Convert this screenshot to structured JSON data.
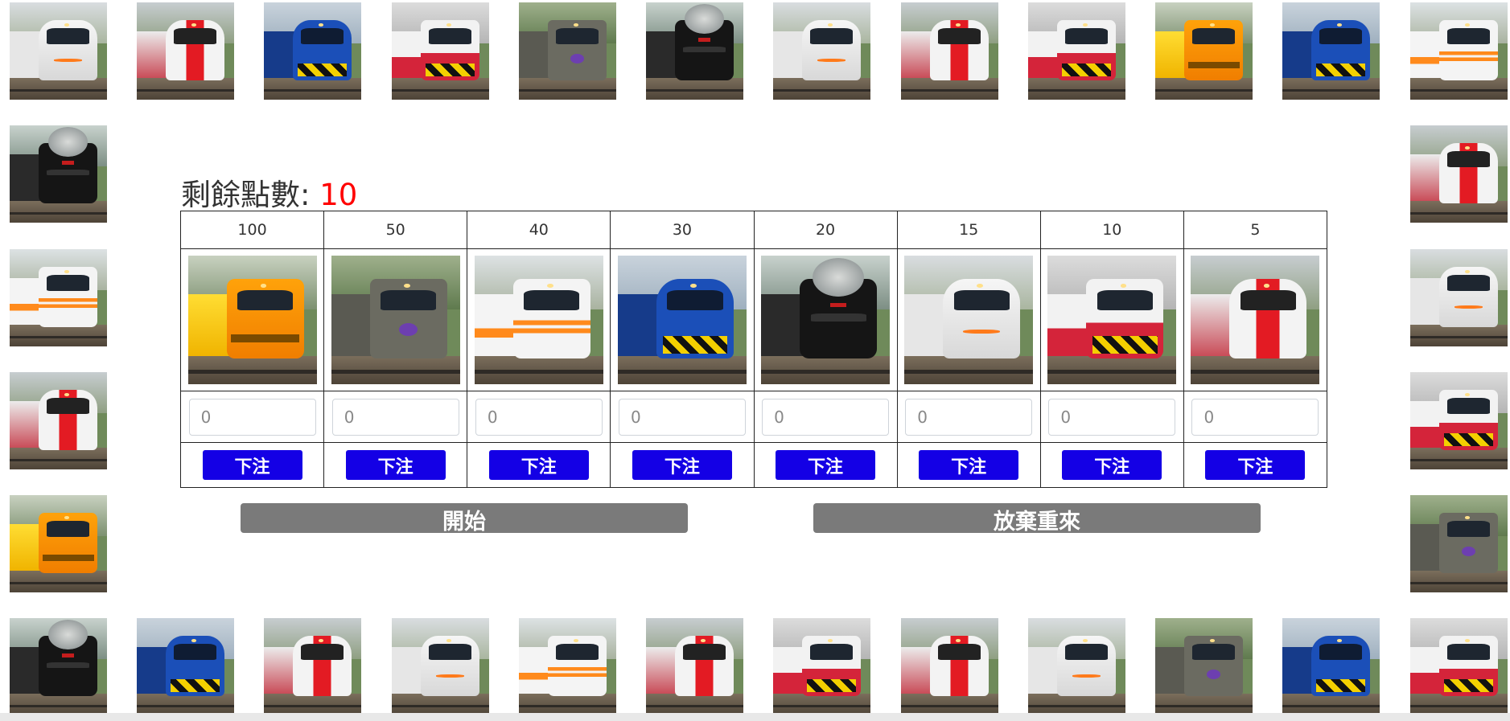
{
  "points": {
    "label": "剩餘點數:",
    "value": "10"
  },
  "bets": [
    {
      "odds": "100",
      "train": "orange",
      "placeholder": "0",
      "button": "下注"
    },
    {
      "odds": "50",
      "train": "grey",
      "placeholder": "0",
      "button": "下注"
    },
    {
      "odds": "40",
      "train": "stripe",
      "placeholder": "0",
      "button": "下注"
    },
    {
      "odds": "30",
      "train": "blue",
      "placeholder": "0",
      "button": "下注"
    },
    {
      "odds": "20",
      "train": "steam",
      "placeholder": "0",
      "button": "下注"
    },
    {
      "odds": "15",
      "train": "white",
      "placeholder": "0",
      "button": "下注"
    },
    {
      "odds": "10",
      "train": "emu",
      "placeholder": "0",
      "button": "下注"
    },
    {
      "odds": "5",
      "train": "redwhite",
      "placeholder": "0",
      "button": "下注"
    }
  ],
  "controls": {
    "start": "開始",
    "reset": "放棄重來"
  },
  "colors": {
    "points_value": "#ff0000",
    "bet_button": "#1400e5",
    "control_button": "#7a7a7a"
  },
  "board": {
    "top": [
      "white",
      "redwhite",
      "blue",
      "emu",
      "grey",
      "steam",
      "white",
      "redwhite",
      "emu",
      "orange",
      "blue",
      "stripe"
    ],
    "right": [
      "redwhite",
      "white",
      "emu",
      "grey"
    ],
    "bottom": [
      "steam",
      "blue",
      "redwhite",
      "white",
      "stripe",
      "redwhite",
      "emu",
      "redwhite",
      "white",
      "grey",
      "blue",
      "emu"
    ],
    "left": [
      "steam",
      "stripe",
      "redwhite",
      "orange"
    ]
  }
}
